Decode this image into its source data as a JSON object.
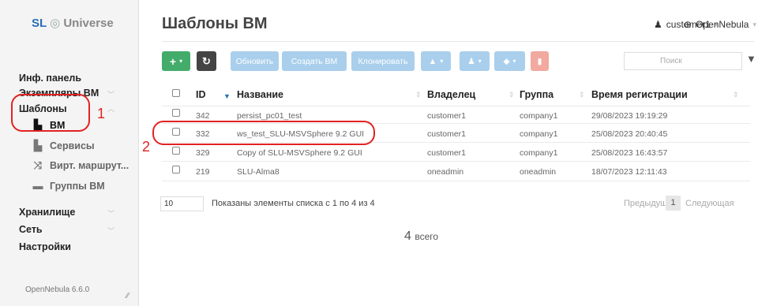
{
  "logo": {
    "sl": "SL",
    "circle": "◎",
    "name": "Universe"
  },
  "sidebar": {
    "items": [
      {
        "label": "Инф. панель"
      },
      {
        "label": "Экземпляры ВМ"
      },
      {
        "label": "Шаблоны"
      },
      {
        "label": "ВМ"
      },
      {
        "label": "Сервисы"
      },
      {
        "label": "Вирт. маршрут..."
      },
      {
        "label": "Группы ВМ"
      },
      {
        "label": "Хранилище"
      },
      {
        "label": "Сеть"
      },
      {
        "label": "Настройки"
      }
    ],
    "version": "OpenNebula 6.6.0"
  },
  "header": {
    "title": "Шаблоны ВМ",
    "user": "customer1",
    "cloud": "OpenNebula"
  },
  "toolbar": {
    "add": "+",
    "refresh_icon": "refresh-icon",
    "update": "Обновить",
    "create_vm": "Создать ВМ",
    "clone": "Клонировать",
    "search_placeholder": "Поиск"
  },
  "table": {
    "columns": [
      "ID",
      "Название",
      "Владелец",
      "Группа",
      "Время регистрации"
    ],
    "rows": [
      {
        "id": "342",
        "name": "persist_pc01_test",
        "owner": "customer1",
        "group": "company1",
        "time": "29/08/2023 19:19:29"
      },
      {
        "id": "332",
        "name": "ws_test_SLU-MSVSphere 9.2 GUI",
        "owner": "customer1",
        "group": "company1",
        "time": "25/08/2023 20:40:45"
      },
      {
        "id": "329",
        "name": "Copy of SLU-MSVSphere 9.2 GUI",
        "owner": "customer1",
        "group": "company1",
        "time": "25/08/2023 16:43:57"
      },
      {
        "id": "219",
        "name": "SLU-Alma8",
        "owner": "oneadmin",
        "group": "oneadmin",
        "time": "18/07/2023 12:11:43"
      }
    ]
  },
  "footer": {
    "page_size": "10",
    "showing": "Показаны элементы списка с 1 по 4 из 4",
    "prev": "Предыдущая",
    "page": "1",
    "next": "Следующая",
    "total_num": "4",
    "total_word": "всего"
  },
  "annotations": {
    "one": "1",
    "two": "2"
  },
  "colors": {
    "accent_green": "#43ac6a",
    "accent_light_blue": "#a9cfec",
    "annotation_red": "#e32222"
  }
}
